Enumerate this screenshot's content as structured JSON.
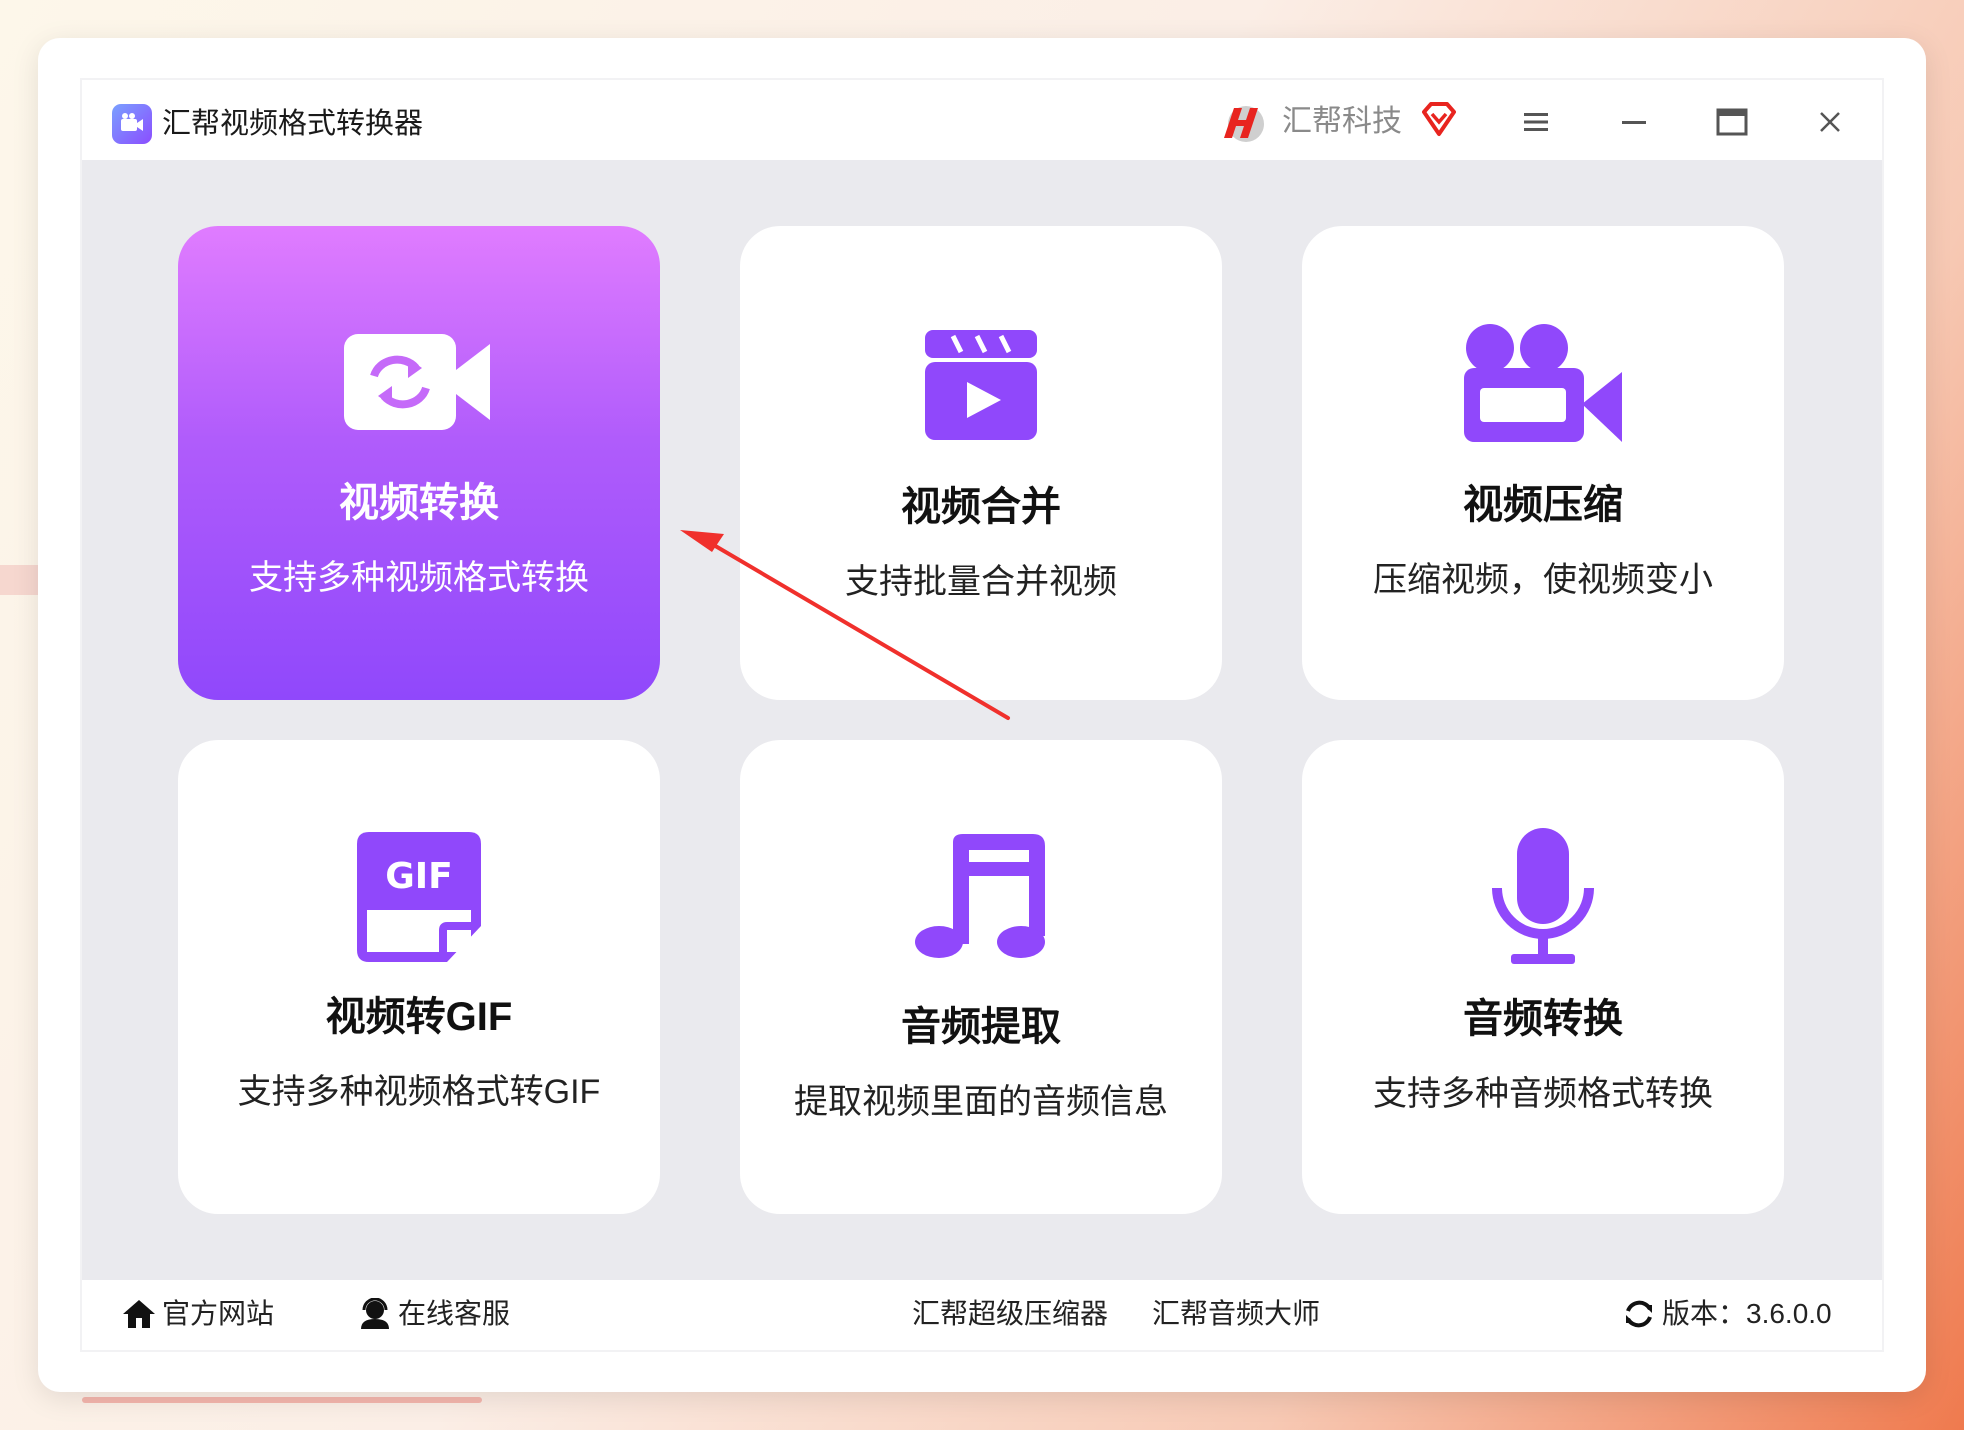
{
  "window": {
    "title": "汇帮视频格式转换器",
    "brand": "汇帮科技"
  },
  "colors": {
    "accent": "#9048fb",
    "accent_light": "#e07cff",
    "arrow": "#f0302c"
  },
  "cards": [
    {
      "title": "视频转换",
      "desc": "支持多种视频格式转换",
      "icon": "video-convert-icon",
      "active": true
    },
    {
      "title": "视频合并",
      "desc": "支持批量合并视频",
      "icon": "clapperboard-icon",
      "active": false
    },
    {
      "title": "视频压缩",
      "desc": "压缩视频，使视频变小",
      "icon": "movie-camera-icon",
      "active": false
    },
    {
      "title": "视频转GIF",
      "desc": "支持多种视频格式转GIF",
      "icon": "gif-file-icon",
      "active": false
    },
    {
      "title": "音频提取",
      "desc": "提取视频里面的音频信息",
      "icon": "music-note-icon",
      "active": false
    },
    {
      "title": "音频转换",
      "desc": "支持多种音频格式转换",
      "icon": "microphone-icon",
      "active": false
    }
  ],
  "footer": {
    "website": "官方网站",
    "support": "在线客服",
    "link1": "汇帮超级压缩器",
    "link2": "汇帮音频大师",
    "version": "版本：3.6.0.0"
  }
}
